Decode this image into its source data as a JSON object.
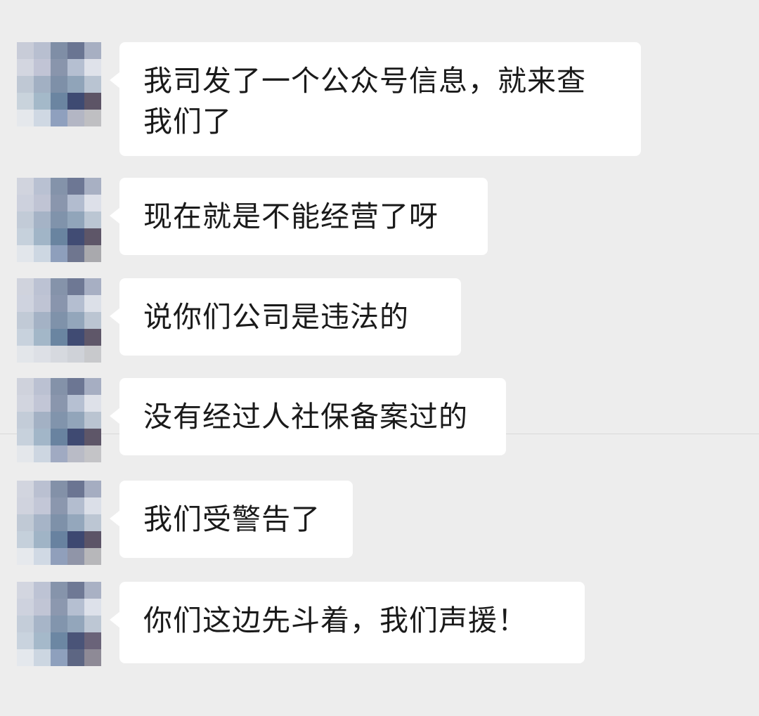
{
  "app": {
    "background": "#ededed",
    "bubble_color": "#ffffff",
    "text_color": "#1a1a1a"
  },
  "messages": [
    {
      "text": "我司发了一个公众号信息，就来查\n我们了",
      "avatar": "pixelated-avatar",
      "palette": [
        "#c8ccd8",
        "#b8bfd0",
        "#7f8ea6",
        "#6a7592",
        "#a7afc2",
        "#d3d6e0",
        "#c1c4d5",
        "#8995ac",
        "#b5bfd1",
        "#dfe2ea",
        "#bfc8d4",
        "#a2b0c3",
        "#7e90a8",
        "#90a4b9",
        "#b9c4d2",
        "#c9d3dc",
        "#a4b9c9",
        "#6b85a1",
        "#3e4a72",
        "#5d5466",
        "#e5e8ec",
        "#cfd8e3",
        "#8fa0be",
        "#b3b6c4",
        "#bfbfc2"
      ]
    },
    {
      "text": "现在就是不能经营了呀",
      "avatar": "pixelated-avatar",
      "palette": [
        "#d1d4de",
        "#b9c1d2",
        "#8493aa",
        "#6d7794",
        "#a8b0c3",
        "#cdd1dd",
        "#c0c4d4",
        "#8a96ad",
        "#b2bccf",
        "#dde0e9",
        "#c2cbd7",
        "#a5b3c6",
        "#8093ab",
        "#91a5ba",
        "#bbc6d3",
        "#c6d1dc",
        "#a1b5c7",
        "#6984a0",
        "#414c74",
        "#5e5668",
        "#e2e6eb",
        "#cdd7e2",
        "#8e9fbc",
        "#6f768f",
        "#a9a9ad"
      ]
    },
    {
      "text": "说你们公司是违法的",
      "avatar": "pixelated-avatar",
      "palette": [
        "#d0d3dd",
        "#bcc2d3",
        "#8593aa",
        "#6e7894",
        "#a7afc3",
        "#cfd3df",
        "#bfc4d4",
        "#8995ad",
        "#b4bed0",
        "#dce0e8",
        "#c1cad6",
        "#a4b2c5",
        "#7f92aa",
        "#93a6bb",
        "#bbc5d2",
        "#c8d2dd",
        "#a3b7c8",
        "#6a85a1",
        "#404b73",
        "#5f5769",
        "#e3e6ea",
        "#dde0e6",
        "#d6d9df",
        "#cfd2d8",
        "#c8c9cc"
      ]
    },
    {
      "text": "没有经过人社保备案过的",
      "avatar": "pixelated-avatar",
      "palette": [
        "#cfd2dc",
        "#bbc1d2",
        "#8492a9",
        "#6c7693",
        "#a6aec2",
        "#d2d5df",
        "#c2c6d6",
        "#8a96ad",
        "#b6c0d2",
        "#dee1e9",
        "#c3ccd8",
        "#a3b1c4",
        "#8194ac",
        "#92a5ba",
        "#bac4d1",
        "#c7d1dc",
        "#a2b6c8",
        "#6983a0",
        "#3f4a72",
        "#5e5668",
        "#e4e7eb",
        "#cdd6e1",
        "#a0aac2",
        "#b9bbc6",
        "#c4c4c7"
      ]
    },
    {
      "text": "我们受警告了",
      "avatar": "pixelated-avatar",
      "palette": [
        "#d2d5df",
        "#bac0d1",
        "#8391a8",
        "#6b7592",
        "#a5adc1",
        "#d0d3de",
        "#c3c7d7",
        "#8b97ae",
        "#b3bdcf",
        "#dbdfe8",
        "#c0c9d5",
        "#a6b4c7",
        "#7e91a9",
        "#94a7bc",
        "#bcc6d3",
        "#c5d0db",
        "#a0b4c6",
        "#6882a0",
        "#3d4871",
        "#5c5467",
        "#e6e9ed",
        "#d0d9e4",
        "#909fbb",
        "#9095a8",
        "#b7b7ba"
      ]
    },
    {
      "text": "你们这边先斗着，我们声援！",
      "avatar": "pixelated-avatar",
      "palette": [
        "#d3d6e0",
        "#bdc3d4",
        "#8694ab",
        "#6f7995",
        "#a9b1c4",
        "#ced2de",
        "#c1c5d5",
        "#8c98af",
        "#b5bfd1",
        "#dde1ea",
        "#c4cdd9",
        "#a7b5c8",
        "#8295ad",
        "#93a6bb",
        "#bdc7d4",
        "#c9d3de",
        "#a5b9ca",
        "#6c87a3",
        "#4a5478",
        "#6a6379",
        "#e4e8ed",
        "#ccd6e1",
        "#8ea0bd",
        "#5d6683",
        "#8e8a96"
      ]
    }
  ]
}
